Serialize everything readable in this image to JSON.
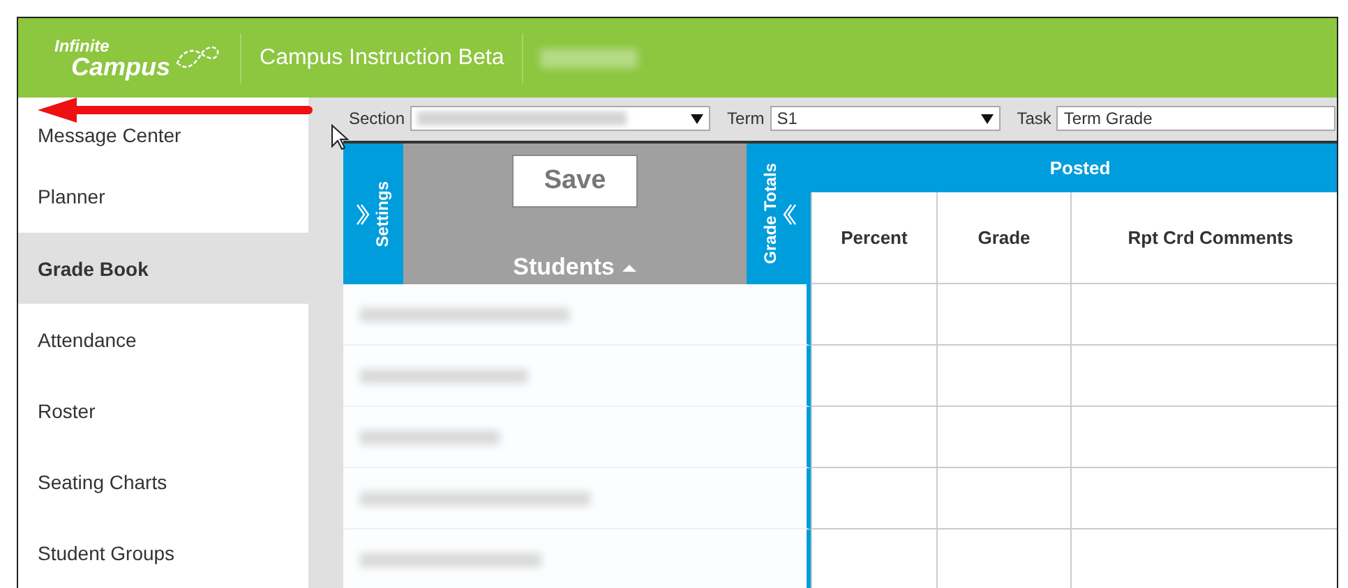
{
  "header": {
    "logo": {
      "line1": "Infinite",
      "line2": "Campus"
    },
    "app_title": "Campus Instruction Beta"
  },
  "sidebar": {
    "items": [
      {
        "label": "Message Center",
        "selected": false
      },
      {
        "label": "Planner",
        "selected": false
      },
      {
        "label": "Grade Book",
        "selected": true
      },
      {
        "label": "Attendance",
        "selected": false
      },
      {
        "label": "Roster",
        "selected": false
      },
      {
        "label": "Seating Charts",
        "selected": false
      },
      {
        "label": "Student Groups",
        "selected": false
      }
    ]
  },
  "toolbar": {
    "fields": [
      {
        "label": "Section"
      },
      {
        "label": "Term",
        "value": "S1"
      },
      {
        "label": "Task",
        "value": "Term Grade"
      }
    ]
  },
  "gradebook": {
    "settings_tab": "Settings",
    "save_button": "Save",
    "students_header": "Students",
    "grade_totals_tab": "Grade Totals",
    "posted_header": "Posted",
    "columns": [
      "Percent",
      "Grade",
      "Rpt Crd Comments"
    ]
  }
}
